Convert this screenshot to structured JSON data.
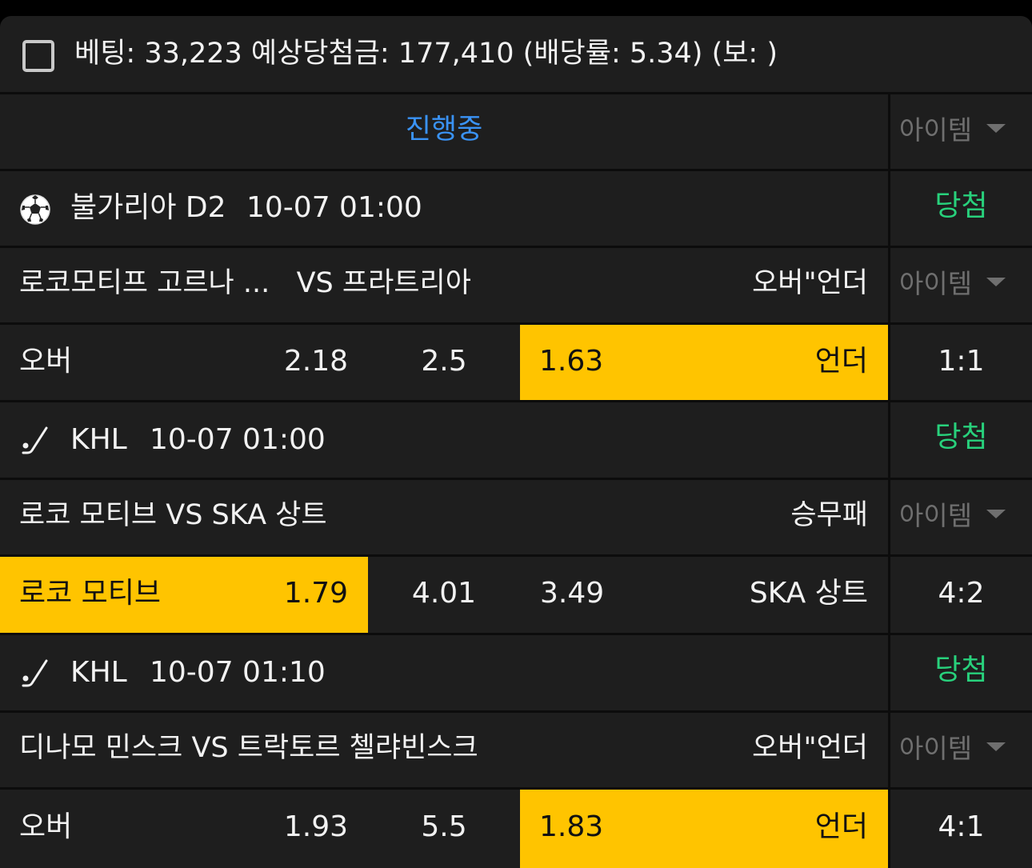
{
  "summary": "베팅: 33,223 예상당첨금: 177,410 (배당률: 5.34) (보: )",
  "status_tab": "진행중",
  "item_label": "아이템",
  "colors": {
    "highlight": "#ffc400",
    "win": "#28d17c",
    "tab": "#3a93f5"
  },
  "games": [
    {
      "sport_icon": "soccer-ball-icon",
      "league": "불가리아 D2",
      "time": "10-07 01:00",
      "result": "당첨",
      "matchup": "로코모티프 고르나 ...   VS 프라트리아",
      "market": "오버\"언더",
      "odds": {
        "left_label": "오버",
        "left": "2.18",
        "mid": "2.5",
        "right": "1.63",
        "right_label": "언더"
      },
      "selected": "right",
      "score": "1:1"
    },
    {
      "sport_icon": "hockey-stick-icon",
      "league": "KHL",
      "time": "10-07 01:00",
      "result": "당첨",
      "matchup": "로코 모티브 VS SKA 상트",
      "market": "승무패",
      "odds": {
        "left_label": "로코 모티브",
        "left": "1.79",
        "mid": "4.01",
        "right": "3.49",
        "right_label": "SKA 상트"
      },
      "selected": "left",
      "score": "4:2"
    },
    {
      "sport_icon": "hockey-stick-icon",
      "league": "KHL",
      "time": "10-07 01:10",
      "result": "당첨",
      "matchup": "디나모 민스크 VS 트락토르 첼랴빈스크",
      "market": "오버\"언더",
      "odds": {
        "left_label": "오버",
        "left": "1.93",
        "mid": "5.5",
        "right": "1.83",
        "right_label": "언더"
      },
      "selected": "right",
      "score": "4:1"
    }
  ]
}
